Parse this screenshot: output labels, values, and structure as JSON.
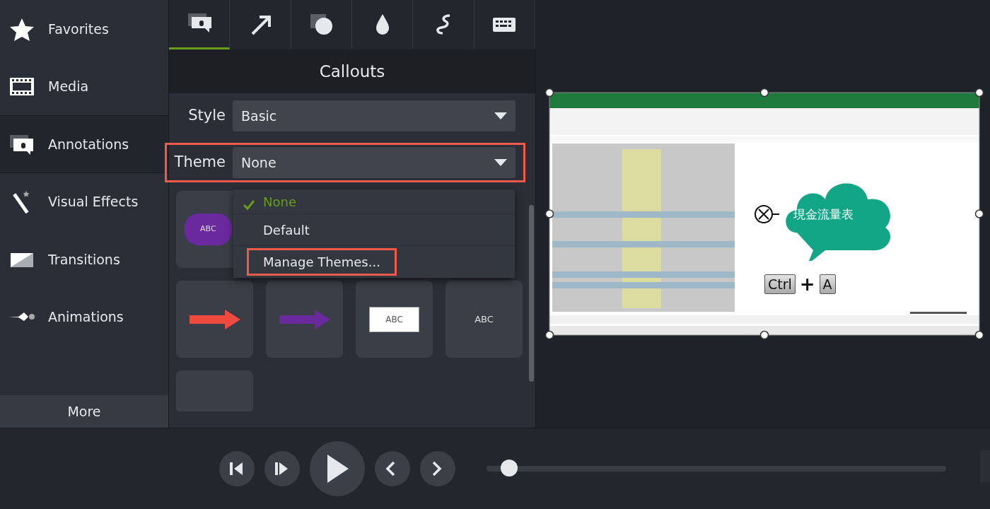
{
  "sidebar": {
    "items": [
      {
        "label": "Favorites",
        "selected": false
      },
      {
        "label": "Media",
        "selected": false
      },
      {
        "label": "Annotations",
        "selected": true
      },
      {
        "label": "Visual Effects",
        "selected": false
      },
      {
        "label": "Transitions",
        "selected": false
      },
      {
        "label": "Animations",
        "selected": false
      }
    ],
    "more_button": "More"
  },
  "panel": {
    "tabs": [
      {
        "selected": true
      },
      {
        "selected": false
      },
      {
        "selected": false
      },
      {
        "selected": false
      },
      {
        "selected": false
      },
      {
        "selected": false
      }
    ],
    "title": "Callouts",
    "style_field": {
      "label": "Style",
      "value": "Basic"
    },
    "theme_field": {
      "label": "Theme",
      "value": "None",
      "highlighted": true
    },
    "theme_menu": [
      {
        "label": "None",
        "selected": true,
        "highlighted": false
      },
      {
        "label": "Default",
        "selected": false,
        "highlighted": false
      },
      {
        "label": "Manage Themes...",
        "selected": false,
        "highlighted": true
      }
    ],
    "tiles": [
      {
        "kind": "bubble",
        "label": "ABC"
      },
      {
        "kind": "arrow",
        "color": "#f04a3e"
      },
      {
        "kind": "arrow",
        "color": "#6a2a9e"
      },
      {
        "kind": "box",
        "label": "ABC"
      },
      {
        "kind": "plain",
        "label": "ABC"
      },
      {
        "kind": "cut"
      }
    ]
  },
  "canvas": {
    "callout_text": "現金流量表",
    "keys": [
      "Ctrl",
      "+",
      "A"
    ]
  },
  "playback": {
    "level": 0.03
  }
}
